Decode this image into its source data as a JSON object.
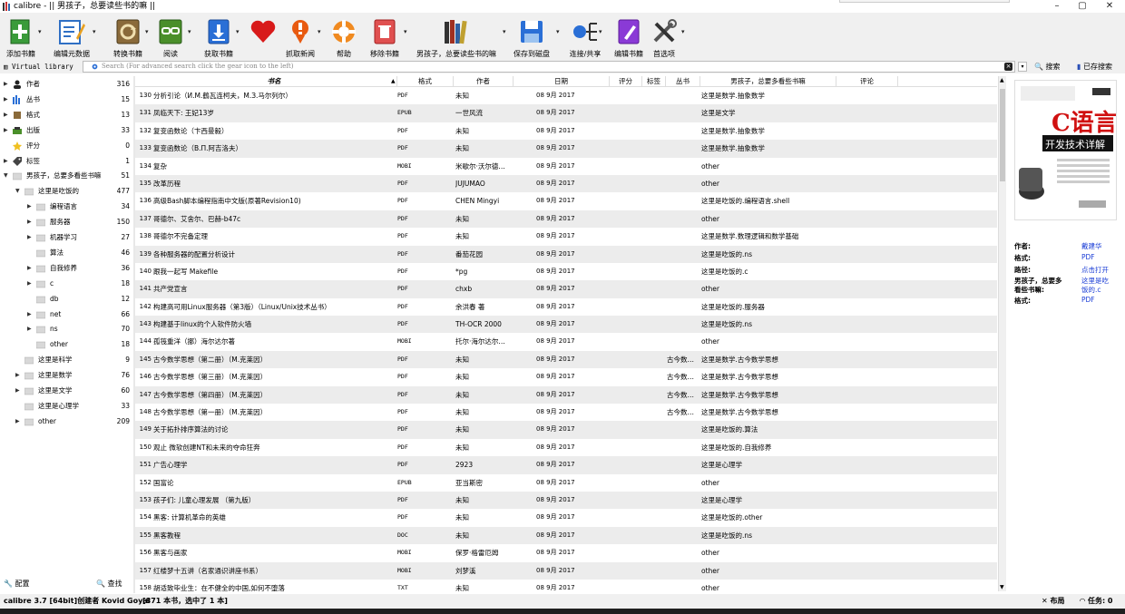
{
  "window": {
    "title": "calibre - || 男孩子，总要读些书的嘛 ||",
    "min": "–",
    "max": "▢",
    "close": "✕"
  },
  "toolbar": {
    "add_books": "添加书籍",
    "edit_metadata": "编辑元数据",
    "convert_books": "转换书籍",
    "view": "阅读",
    "get_books": "获取书籍",
    "fetch_news": "抓取新闻",
    "help": "帮助",
    "remove_books": "移除书籍",
    "library": "男孩子，总要读些书的嘛",
    "save_to_disk": "保存到磁盘",
    "connect_share": "连接/共享",
    "edit_book": "编辑书籍",
    "preferences": "首选项"
  },
  "search": {
    "virtual_library": "Virtual library",
    "placeholder": "Search (For advanced search click the gear icon to the left)",
    "search_label": "搜索",
    "saved_label": "已存搜索"
  },
  "sidebar": {
    "items": [
      {
        "label": "作者",
        "count": "316"
      },
      {
        "label": "丛书",
        "count": "15"
      },
      {
        "label": "格式",
        "count": "13"
      },
      {
        "label": "出版",
        "count": "33"
      },
      {
        "label": "评分",
        "count": "0"
      },
      {
        "label": "标签",
        "count": "1"
      },
      {
        "label": "男孩子，总要多看些书嘛",
        "count": "51"
      },
      {
        "label": "这里是吃饭的",
        "count": "477"
      },
      {
        "label": "编程语言",
        "count": "34"
      },
      {
        "label": "服务器",
        "count": "150"
      },
      {
        "label": "机器学习",
        "count": "27"
      },
      {
        "label": "算法",
        "count": "46"
      },
      {
        "label": "自我修养",
        "count": "36"
      },
      {
        "label": "c",
        "count": "18"
      },
      {
        "label": "db",
        "count": "12"
      },
      {
        "label": "net",
        "count": "66"
      },
      {
        "label": "ns",
        "count": "70"
      },
      {
        "label": "other",
        "count": "18"
      },
      {
        "label": "这里是科学",
        "count": "9"
      },
      {
        "label": "这里是数学",
        "count": "76"
      },
      {
        "label": "这里是文学",
        "count": "60"
      },
      {
        "label": "这里是心理学",
        "count": "33"
      },
      {
        "label": "other",
        "count": "209"
      }
    ],
    "configure": "配置",
    "find": "查找"
  },
  "table": {
    "columns": {
      "title": "书名",
      "format": "格式",
      "author": "作者",
      "date": "日期",
      "rating": "评分",
      "tags": "标签",
      "series": "丛书",
      "collection": "男孩子，总要多看些书嘛",
      "comments": "评论"
    },
    "rows": [
      {
        "num": "130",
        "title": "分析引论（И.М.鶴瓦连柯夫，М.З.马尔列尔）",
        "format": "PDF",
        "author": "未知",
        "date": "08 9月 2017",
        "series": "",
        "collection": "这里是数学.抽象数学"
      },
      {
        "num": "131",
        "title": "凤临天下: 王妃13岁",
        "format": "EPUB",
        "author": "一世风流",
        "date": "08 9月 2017",
        "series": "",
        "collection": "这里是文学"
      },
      {
        "num": "132",
        "title": "复变函数论（卞西曼毅）",
        "format": "PDF",
        "author": "未知",
        "date": "08 9月 2017",
        "series": "",
        "collection": "这里是数学.抽象数学"
      },
      {
        "num": "133",
        "title": "复变函数论（В.П.阿吉洛夫）",
        "format": "PDF",
        "author": "未知",
        "date": "08 9月 2017",
        "series": "",
        "collection": "这里是数学.抽象数学"
      },
      {
        "num": "134",
        "title": "复杂",
        "format": "MOBI",
        "author": "米歇尔·沃尔德…",
        "date": "08 9月 2017",
        "series": "",
        "collection": "other"
      },
      {
        "num": "135",
        "title": "改革历程",
        "format": "PDF",
        "author": "JUJUMAO",
        "date": "08 9月 2017",
        "series": "",
        "collection": "other"
      },
      {
        "num": "136",
        "title": "高级Bash脚本编程指南中文版(原著Revision10)",
        "format": "PDF",
        "author": "CHEN Mingyi",
        "date": "08 9月 2017",
        "series": "",
        "collection": "这里是吃饭的.编程语言.shell"
      },
      {
        "num": "137",
        "title": "哥德尔、艾舍尔、巴赫-b47c",
        "format": "PDF",
        "author": "未知",
        "date": "08 9月 2017",
        "series": "",
        "collection": "other"
      },
      {
        "num": "138",
        "title": "哥德尔不完备定理",
        "format": "PDF",
        "author": "未知",
        "date": "08 9月 2017",
        "series": "",
        "collection": "这里是数学.数理逻辑和数学基础"
      },
      {
        "num": "139",
        "title": "各种服务器的配置分析设计",
        "format": "PDF",
        "author": "番茄花园",
        "date": "08 9月 2017",
        "series": "",
        "collection": "这里是吃饭的.ns"
      },
      {
        "num": "140",
        "title": "跟我一起写 Makefile",
        "format": "PDF",
        "author": "*pg",
        "date": "08 9月 2017",
        "series": "",
        "collection": "这里是吃饭的.c"
      },
      {
        "num": "141",
        "title": "共产党宣言",
        "format": "PDF",
        "author": "chxb",
        "date": "08 9月 2017",
        "series": "",
        "collection": "other"
      },
      {
        "num": "142",
        "title": "构建高可用Linux服务器（第3版）（Linux/Unix技术丛书）",
        "format": "PDF",
        "author": "余洪春 著",
        "date": "08 9月 2017",
        "series": "",
        "collection": "这里是吃饭的.服务器"
      },
      {
        "num": "143",
        "title": "构建基于linux的个人软件防火墙",
        "format": "PDF",
        "author": "TH-OCR 2000",
        "date": "08 9月 2017",
        "series": "",
        "collection": "这里是吃饭的.ns"
      },
      {
        "num": "144",
        "title": "孤筏重洋（挪）海尔达尔著",
        "format": "MOBI",
        "author": "托尔·海尔达尔…",
        "date": "08 9月 2017",
        "series": "",
        "collection": "other"
      },
      {
        "num": "145",
        "title": "古今数学思想（第二册）（M.克莱因）",
        "format": "PDF",
        "author": "未知",
        "date": "08 9月 2017",
        "series": "古今数…",
        "collection": "这里是数学.古今数学思想"
      },
      {
        "num": "146",
        "title": "古今数学思想（第三册）（M.克莱因）",
        "format": "PDF",
        "author": "未知",
        "date": "08 9月 2017",
        "series": "古今数…",
        "collection": "这里是数学.古今数学思想"
      },
      {
        "num": "147",
        "title": "古今数学思想（第四册）（M.克莱因）",
        "format": "PDF",
        "author": "未知",
        "date": "08 9月 2017",
        "series": "古今数…",
        "collection": "这里是数学.古今数学思想"
      },
      {
        "num": "148",
        "title": "古今数学思想（第一册）（M.克莱因）",
        "format": "PDF",
        "author": "未知",
        "date": "08 9月 2017",
        "series": "古今数…",
        "collection": "这里是数学.古今数学思想"
      },
      {
        "num": "149",
        "title": "关于拓扑排序算法的讨论",
        "format": "PDF",
        "author": "未知",
        "date": "08 9月 2017",
        "series": "",
        "collection": "这里是吃饭的.算法"
      },
      {
        "num": "150",
        "title": "观止 微软创建NT和未来的夺命狂奔",
        "format": "PDF",
        "author": "未知",
        "date": "08 9月 2017",
        "series": "",
        "collection": "这里是吃饭的.自我修养"
      },
      {
        "num": "151",
        "title": "广告心理学",
        "format": "PDF",
        "author": "2923",
        "date": "08 9月 2017",
        "series": "",
        "collection": "这里是心理学"
      },
      {
        "num": "152",
        "title": "国富论",
        "format": "EPUB",
        "author": "亚当斯密",
        "date": "08 9月 2017",
        "series": "",
        "collection": "other"
      },
      {
        "num": "153",
        "title": "孩子们: 儿童心理发展 （第九版）",
        "format": "PDF",
        "author": "未知",
        "date": "08 9月 2017",
        "series": "",
        "collection": "这里是心理学"
      },
      {
        "num": "154",
        "title": "黑客: 计算机革命的英雄",
        "format": "PDF",
        "author": "未知",
        "date": "08 9月 2017",
        "series": "",
        "collection": "这里是吃饭的.other"
      },
      {
        "num": "155",
        "title": "黑客教程",
        "format": "DOC",
        "author": "未知",
        "date": "08 9月 2017",
        "series": "",
        "collection": "这里是吃饭的.ns"
      },
      {
        "num": "156",
        "title": "黑客与画家",
        "format": "MOBI",
        "author": "保罗·格雷厄姆",
        "date": "08 9月 2017",
        "series": "",
        "collection": "other"
      },
      {
        "num": "157",
        "title": "红楼梦十五讲（名家通识讲座书系）",
        "format": "MOBI",
        "author": "刘梦溪",
        "date": "08 9月 2017",
        "series": "",
        "collection": "other"
      },
      {
        "num": "158",
        "title": "胡适致毕业生：在不健全的中国,如何不堕落",
        "format": "TXT",
        "author": "未知",
        "date": "08 9月 2017",
        "series": "",
        "collection": "other"
      }
    ]
  },
  "details": {
    "cover_title": "C语言",
    "cover_subtitle": "开发技术详解",
    "author_label": "作者:",
    "author_value": "戴建华",
    "format_label": "格式:",
    "format_value": "PDF",
    "path_label": "路径:",
    "path_value": "点击打开",
    "col_label_1": "男孩子，总要多",
    "col_label_2": "看些书嘛:",
    "col_value_1": "这里是吃",
    "col_value_2": "饭的.c",
    "format2_label": "格式:",
    "format2_value": "PDF"
  },
  "status": {
    "left": "calibre 3.7 [64bit]创建者 Kovid Goyal",
    "count": "[871 本书，选中了 1 本]",
    "layout": "布局",
    "jobs": "任务: 0"
  },
  "colors": {
    "accent": "#1a3dd6",
    "toolbar_bg": "#f0f0f0",
    "row_alt": "#ececec"
  }
}
